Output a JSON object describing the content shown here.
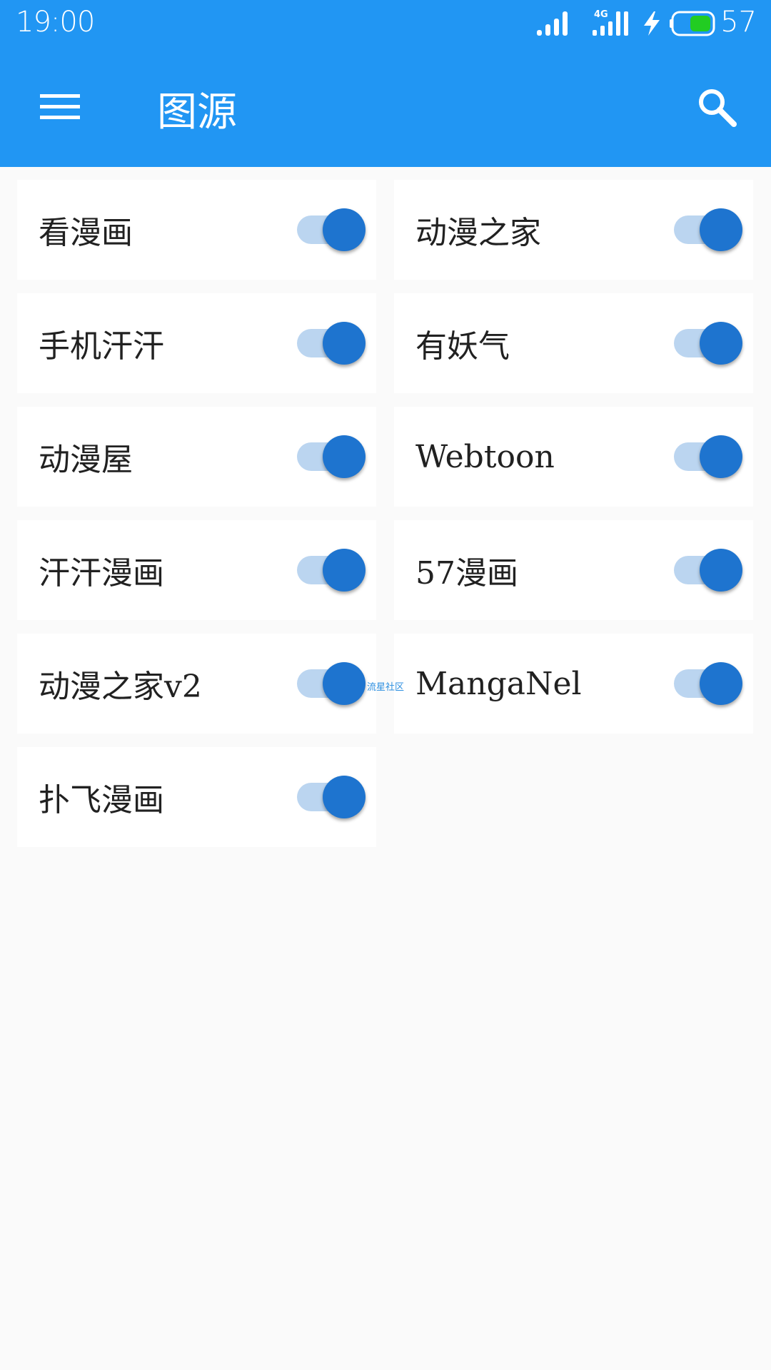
{
  "status_bar": {
    "time": "19:00",
    "network": "4G",
    "battery_percent": "57",
    "battery_color": "#22cc22"
  },
  "app_bar": {
    "title": "图源",
    "menu_icon": "hamburger-menu-icon",
    "search_icon": "search-icon",
    "background": "#2196f3"
  },
  "sources": [
    {
      "label": "看漫画",
      "enabled": true
    },
    {
      "label": "动漫之家",
      "enabled": true
    },
    {
      "label": "手机汗汗",
      "enabled": true
    },
    {
      "label": "有妖气",
      "enabled": true
    },
    {
      "label": "动漫屋",
      "enabled": true
    },
    {
      "label": "Webtoon",
      "enabled": true
    },
    {
      "label": "汗汗漫画",
      "enabled": true
    },
    {
      "label": "57漫画",
      "enabled": true
    },
    {
      "label": "动漫之家v2",
      "enabled": true
    },
    {
      "label": "MangaNel",
      "enabled": true
    },
    {
      "label": "扑飞漫画",
      "enabled": true
    }
  ],
  "watermark": "流星社区",
  "colors": {
    "toggle_thumb": "#1e74cf",
    "toggle_track": "#bbd5f0",
    "page_background": "#fafafa"
  }
}
